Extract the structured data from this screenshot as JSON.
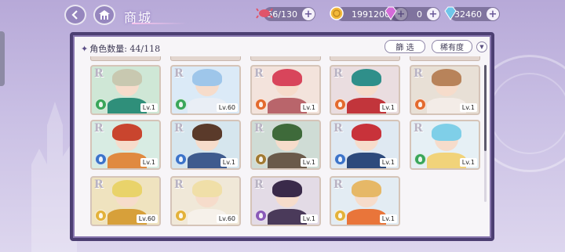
{
  "header": {
    "title": "商城",
    "resources": [
      {
        "name": "stamina",
        "value": "56/130",
        "icon": "candy-icon",
        "color": "#e0546a"
      },
      {
        "name": "gold",
        "value": "1991200",
        "icon": "gold-coin-icon",
        "color": "#f2b93b"
      },
      {
        "name": "gems",
        "value": "0",
        "icon": "pink-gem-icon",
        "color": "#d46bd8"
      },
      {
        "name": "diamonds",
        "value": "32460",
        "icon": "diamond-icon",
        "color": "#6fc6ea"
      }
    ]
  },
  "panel": {
    "count_label": "角色数量: 44/118",
    "filter_label": "篩 选",
    "rarity_label": "稀有度",
    "sort_icon": "chevron-down-icon"
  },
  "cards": [
    {
      "rank": "R",
      "level": "Lv.1",
      "element_color": "#3aa65a",
      "hair": "#c8c8b0",
      "bg": "#cfe7d6",
      "outfit": "#2f8f7a"
    },
    {
      "rank": "R",
      "level": "Lv.60",
      "element_color": "#3aa65a",
      "hair": "#9ec6ea",
      "bg": "#dbeaf7",
      "outfit": "#e9eef5"
    },
    {
      "rank": "R",
      "level": "Lv.1",
      "element_color": "#e36a2e",
      "hair": "#d8455b",
      "bg": "#f3e3dc",
      "outfit": "#b9656b"
    },
    {
      "rank": "R",
      "level": "Lv.1",
      "element_color": "#e36a2e",
      "hair": "#2f8f8a",
      "bg": "#eadde0",
      "outfit": "#c2353b"
    },
    {
      "rank": "R",
      "level": "Lv.1",
      "element_color": "#e36a2e",
      "hair": "#b8835a",
      "bg": "#e8e0d6",
      "outfit": "#f3ece7"
    },
    {
      "rank": "R",
      "level": "Lv.1",
      "element_color": "#3c74c9",
      "hair": "#c9452e",
      "bg": "#d8ece3",
      "outfit": "#e08a40"
    },
    {
      "rank": "R",
      "level": "Lv.1",
      "element_color": "#3c74c9",
      "hair": "#5a3a2a",
      "bg": "#d6e6ee",
      "outfit": "#3f5b8e"
    },
    {
      "rank": "R",
      "level": "Lv.1",
      "element_color": "#a07a32",
      "hair": "#3e6a3a",
      "bg": "#cfdcd5",
      "outfit": "#6a5a4a"
    },
    {
      "rank": "R",
      "level": "Lv.1",
      "element_color": "#3c74c9",
      "hair": "#c8323a",
      "bg": "#dfe9f2",
      "outfit": "#2d4a7c"
    },
    {
      "rank": "R",
      "level": "Lv.1",
      "element_color": "#3aa65a",
      "hair": "#7fcfe8",
      "bg": "#e6f0f5",
      "outfit": "#f1d37a"
    },
    {
      "rank": "R",
      "level": "Lv.60",
      "element_color": "#e3b23a",
      "hair": "#e9d36a",
      "bg": "#efe3bf",
      "outfit": "#d7a03a"
    },
    {
      "rank": "R",
      "level": "Lv.60",
      "element_color": "#e3b23a",
      "hair": "#f0dfa8",
      "bg": "#f0e8d8",
      "outfit": "#f6f1ea"
    },
    {
      "rank": "R",
      "level": "Lv.1",
      "element_color": "#8a5ab8",
      "hair": "#3a2a4a",
      "bg": "#e3dbe6",
      "outfit": "#4a3a5a"
    },
    {
      "rank": "R",
      "level": "Lv.1",
      "element_color": "#e3b23a",
      "hair": "#e6b867",
      "bg": "#e3ecf3",
      "outfit": "#e9753a"
    }
  ]
}
